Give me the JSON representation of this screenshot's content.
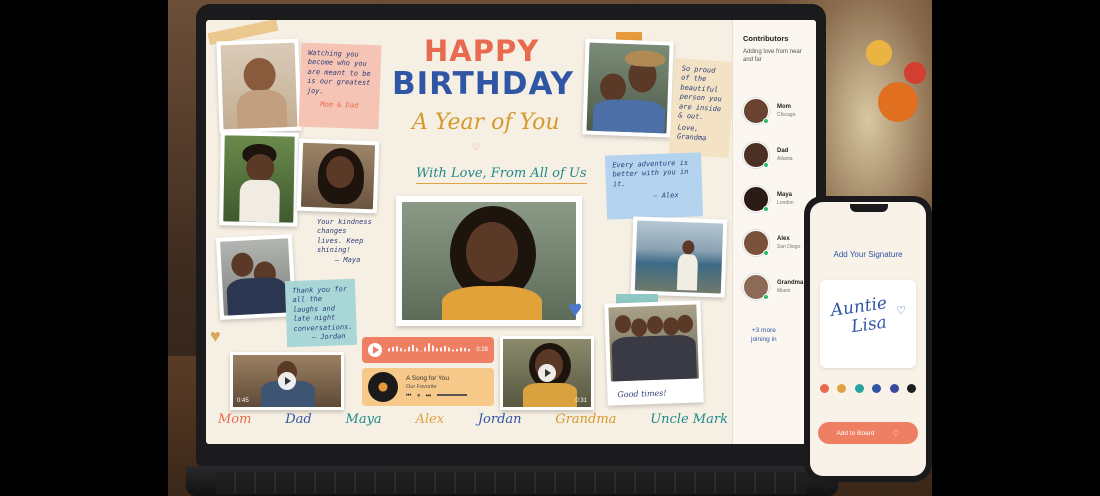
{
  "board": {
    "title_happy": "HAPPY",
    "title_birthday": "BIRTHDAY",
    "title_year": "A Year of You",
    "title_love": "With Love, From All of Us",
    "notes": {
      "parents": "Watching you become who you are meant to be is our greatest joy.",
      "parents_sign": "Mom & Dad",
      "grandma": "So proud of the beautiful person you are inside & out.",
      "grandma_sign": "Love, Grandma",
      "alex": "Every adventure is better with you in it.",
      "alex_sign": "– Alex",
      "maya": "Your kindness changes lives. Keep shining!",
      "maya_sign": "– Maya",
      "jordan": "Thank you for all the laughs and late night conversations.",
      "jordan_sign": "– Jordan",
      "good_times": "Good times!"
    },
    "audio": {
      "duration": "0:28"
    },
    "song": {
      "title": "A Song for You",
      "subtitle": "Our Favorite"
    },
    "video1": {
      "duration": "0:45"
    },
    "video2": {
      "duration": "0:31"
    },
    "signatures": [
      "Mom",
      "Dad",
      "Maya",
      "Alex",
      "Jordan",
      "Grandma",
      "Uncle Mark"
    ]
  },
  "signature_colors": [
    "#e86a4f",
    "#2f55a5",
    "#c05a8a",
    "#e3a241",
    "#1e8a8a",
    "#2f55a5",
    "#1e8a8a"
  ],
  "contributors": {
    "title": "Contributors",
    "subtitle": "Adding love from near and far",
    "people": [
      {
        "name": "Mom",
        "location": "Chicago"
      },
      {
        "name": "Dad",
        "location": "Atlanta"
      },
      {
        "name": "Maya",
        "location": "London"
      },
      {
        "name": "Alex",
        "location": "San Diego"
      },
      {
        "name": "Grandma",
        "location": "Miami"
      }
    ],
    "more": "+3 more",
    "more_sub": "joining in"
  },
  "phone": {
    "title": "Add Your Signature",
    "signature_line1": "Auntie",
    "signature_line2": "Lisa",
    "palette": [
      "#e86a4f",
      "#e3a241",
      "#2aa3a0",
      "#2f55a5",
      "#3a4a9a",
      "#1e1e1e"
    ],
    "add_button": "Add to Board"
  }
}
